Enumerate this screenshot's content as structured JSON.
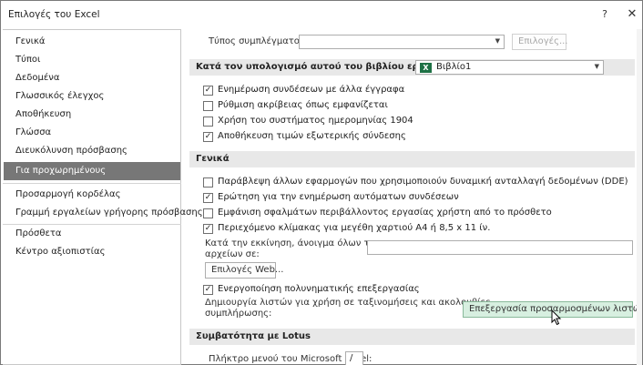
{
  "window": {
    "title": "Επιλογές του Excel",
    "help_icon": "?",
    "close_icon": "✕"
  },
  "sidebar": {
    "items": [
      {
        "label": "Γενικά"
      },
      {
        "label": "Τύποι"
      },
      {
        "label": "Δεδομένα"
      },
      {
        "label": "Γλωσσικός έλεγχος"
      },
      {
        "label": "Αποθήκευση"
      },
      {
        "label": "Γλώσσα"
      },
      {
        "label": "Διευκόλυνση πρόσβασης"
      },
      {
        "label": "Για προχωρημένους"
      },
      {
        "label": "Προσαρμογή κορδέλας"
      },
      {
        "label": "Γραμμή εργαλείων γρήγορης πρόσβασης"
      },
      {
        "label": "Πρόσθετα"
      },
      {
        "label": "Κέντρο αξιοπιστίας"
      }
    ],
    "selected": "Για προχωρημένους"
  },
  "content": {
    "link_type_label": "Τύπος συμπλέγματος:",
    "link_type_value": "",
    "options_button": "Επιλογές...",
    "workbook_section": {
      "label": "Κατά τον υπολογισμό αυτού του βιβλίου εργασίας:",
      "workbook_value": "Βιβλίο1",
      "checkboxes": [
        {
          "label": "Ενημέρωση συνδέσεων με άλλα έγγραφα",
          "checked": true
        },
        {
          "label": "Ρύθμιση ακρίβειας όπως εμφανίζεται",
          "checked": false
        },
        {
          "label": "Χρήση του συστήματος ημερομηνίας 1904",
          "checked": false
        },
        {
          "label": "Αποθήκευση τιμών εξωτερικής σύνδεσης",
          "checked": true
        }
      ]
    },
    "general_section": {
      "label": "Γενικά",
      "checkboxes": [
        {
          "label": "Παράβλεψη άλλων εφαρμογών που χρησιμοποιούν δυναμική ανταλλαγή δεδομένων (DDE)",
          "checked": false
        },
        {
          "label": "Ερώτηση για την ενημέρωση αυτόματων συνδέσεων",
          "checked": true
        },
        {
          "label": "Εμφάνιση σφαλμάτων περιβάλλοντος εργασίας χρήστη από το πρόσθετο",
          "checked": false
        },
        {
          "label": "Περιεχόμενο κλίμακας για μεγέθη χαρτιού A4 ή 8,5 x 11 ίν.",
          "checked": true
        }
      ],
      "startup_label_1": "Κατά την εκκίνηση, άνοιγμα όλων των",
      "startup_label_2": "αρχείων σε:",
      "startup_value": "",
      "web_options_button": "Επιλογές Web...",
      "multithread_checkbox": {
        "label": "Ενεργοποίηση πολυνηματικής επεξεργασίας",
        "checked": true
      },
      "custom_lists_label_1": "Δημιουργία λιστών για χρήση σε ταξινομήσεις και ακολουθίες",
      "custom_lists_label_2": "συμπλήρωσης:",
      "edit_custom_lists_button": "Επεξεργασία προσαρμοσμένων λιστών..."
    },
    "lotus_section": {
      "label": "Συμβατότητα με Lotus",
      "menu_key_label": "Πλήκτρο μενού του Microsoft Excel:",
      "menu_key_value": "/"
    }
  },
  "colors": {
    "selected_nav": "#777777",
    "section_header": "#e8e8e8",
    "hover_button": "#d7efe0",
    "excel_green": "#1e7145"
  }
}
